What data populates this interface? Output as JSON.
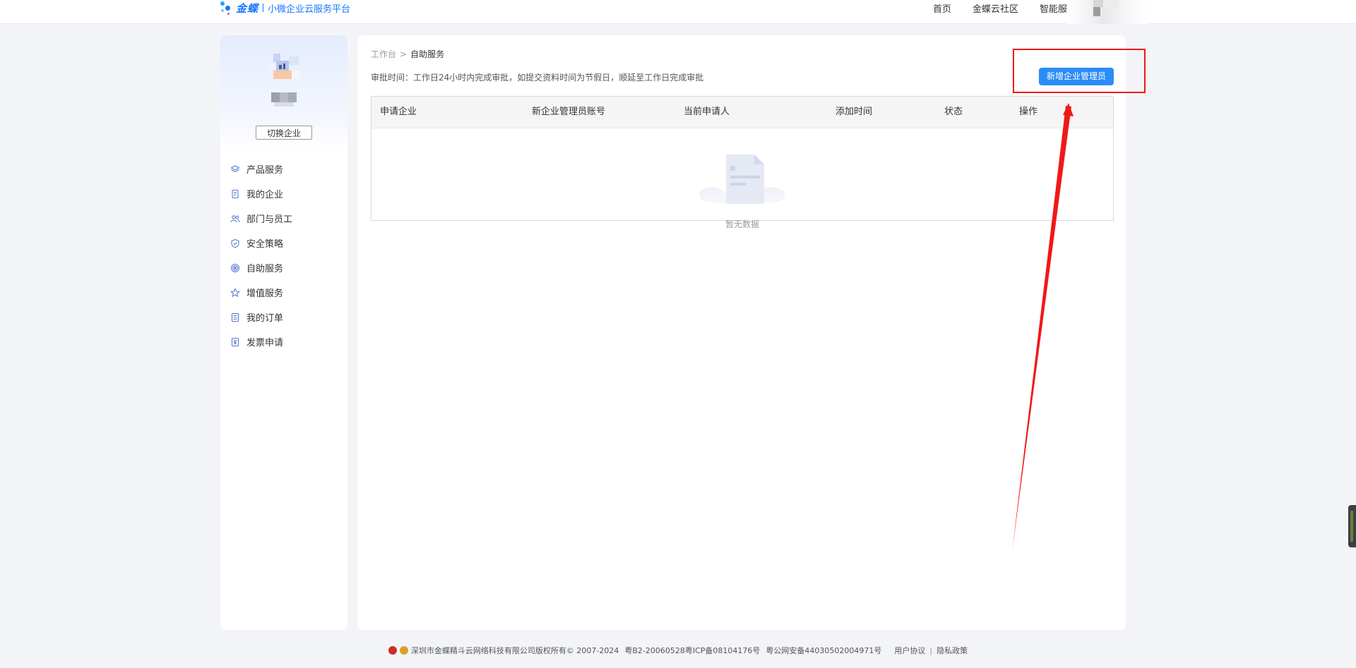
{
  "header": {
    "brand": "金蝶",
    "platform": "小微企业云服务平台",
    "nav": [
      "首页",
      "金蝶云社区",
      "智能服务"
    ]
  },
  "sidebar": {
    "switch_label": "切换企业",
    "items": [
      {
        "label": "产品服务",
        "icon": "layers-icon"
      },
      {
        "label": "我的企业",
        "icon": "building-icon"
      },
      {
        "label": "部门与员工",
        "icon": "users-icon"
      },
      {
        "label": "安全策略",
        "icon": "shield-icon"
      },
      {
        "label": "自助服务",
        "icon": "target-icon"
      },
      {
        "label": "增值服务",
        "icon": "star-icon"
      },
      {
        "label": "我的订单",
        "icon": "list-icon"
      },
      {
        "label": "发票申请",
        "icon": "yen-invoice-icon"
      }
    ]
  },
  "main": {
    "breadcrumb": {
      "root": "工作台",
      "separator": ">",
      "current": "自助服务"
    },
    "notice": "审批时间：工作日24小时内完成审批，如提交资料时间为节假日，顺延至工作日完成审批",
    "add_button": "新增企业管理员",
    "table": {
      "columns": [
        "申请企业",
        "新企业管理员账号",
        "当前申请人",
        "添加时间",
        "状态",
        "操作"
      ],
      "rows": [],
      "empty_text": "暂无数据"
    }
  },
  "footer": {
    "copyright": "深圳市金蝶精斗云网络科技有限公司版权所有© 2007-2024",
    "icp": "粤B2-20060528粤ICP备08104176号",
    "police": "粤公网安备44030502004971号",
    "links": [
      "用户协议",
      "隐私政策"
    ]
  },
  "colors": {
    "accent": "#2b8cf6",
    "brand": "#1677ff",
    "annotation": "#f01818"
  }
}
